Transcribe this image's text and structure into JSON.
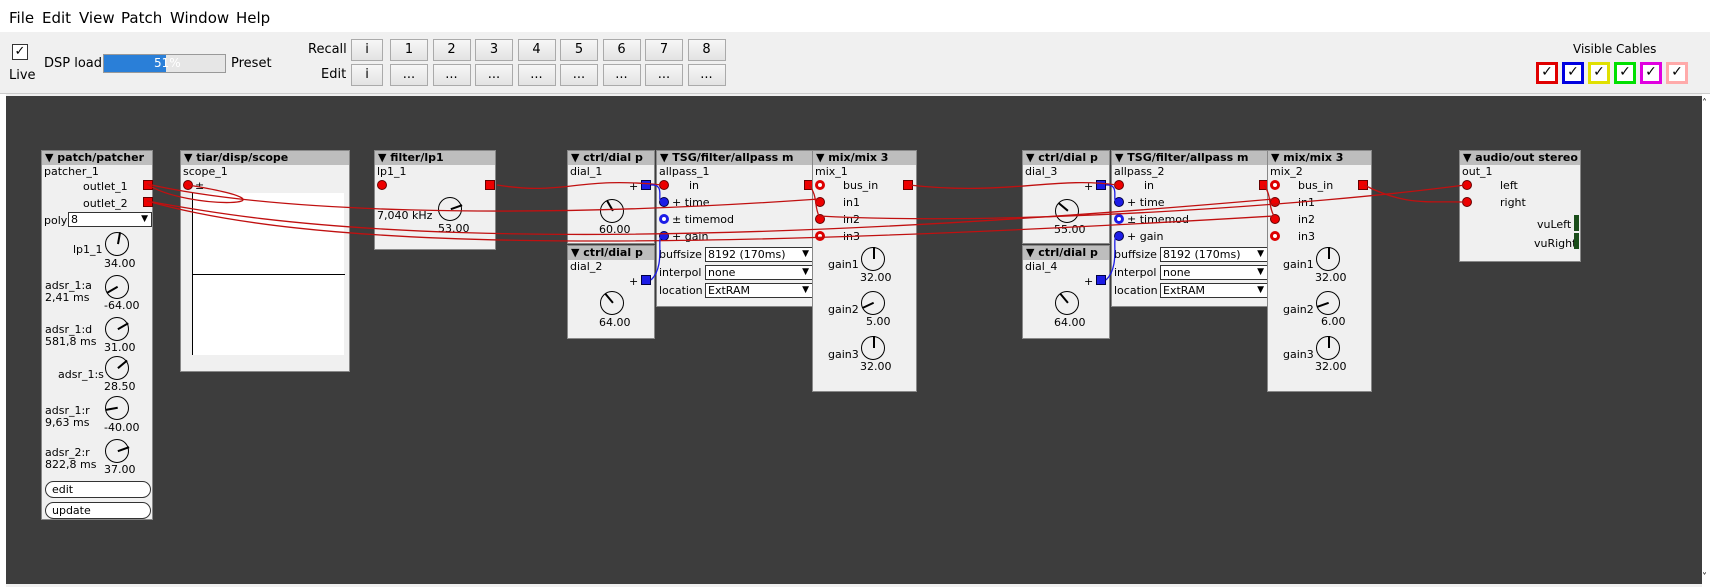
{
  "menu": [
    "File",
    "Edit",
    "View",
    "Patch",
    "Window",
    "Help"
  ],
  "toolbar": {
    "live": "Live",
    "dsp_label": "DSP load",
    "dsp_value": "51%",
    "dsp_fraction": 0.51,
    "preset": "Preset",
    "recall": "Recall",
    "edit": "Edit",
    "recall_buttons": [
      "i",
      "1",
      "2",
      "3",
      "4",
      "5",
      "6",
      "7",
      "8"
    ],
    "edit_buttons": [
      "i",
      "...",
      "...",
      "...",
      "...",
      "...",
      "...",
      "...",
      "..."
    ],
    "visible_cables": "Visible Cables",
    "cable_colors": [
      "#e00000",
      "#0000e0",
      "#e0e000",
      "#00e000",
      "#e000e0",
      "#ffaaaa"
    ]
  },
  "objects": {
    "patcher": {
      "header": "▼ patch/patcher",
      "name": "patcher_1",
      "outlet1": "outlet_1",
      "outlet2": "outlet_2",
      "poly_label": "poly",
      "poly_value": "8",
      "lp1_label": "lp1_1",
      "lp1_value": "34.00",
      "adsr_a_label": "adsr_1:a",
      "adsr_a_sub": "2,41 ms",
      "adsr_a_value": "-64.00",
      "adsr_d_label": "adsr_1:d",
      "adsr_d_sub": "581,8 ms",
      "adsr_d_value": "31.00",
      "adsr_s_label": "adsr_1:s",
      "adsr_s_value": "28.50",
      "adsr_r_label": "adsr_1:r",
      "adsr_r_sub": "9,63 ms",
      "adsr_r_value": "-40.00",
      "adsr2_r_label": "adsr_2:r",
      "adsr2_r_sub": "822,8 ms",
      "adsr2_r_value": "37.00",
      "edit": "edit",
      "update": "update"
    },
    "scope": {
      "header": "▼ tiar/disp/scope",
      "name": "scope_1",
      "plus": "±"
    },
    "lp": {
      "header": "▼ filter/lp1",
      "name": "lp1_1",
      "freq": "7,040 kHz",
      "value": "53.00"
    },
    "dial1": {
      "header": "▼ ctrl/dial p",
      "name": "dial_1",
      "value": "60.00",
      "plus": "+"
    },
    "dial2": {
      "header": "▼ ctrl/dial p",
      "name": "dial_2",
      "value": "64.00",
      "plus": "+"
    },
    "allpass1": {
      "header": "▼ TSG/filter/allpass m",
      "name": "allpass_1",
      "in": "in",
      "time": "+ time",
      "timemod": "± timemod",
      "gain": "+ gain",
      "buffsize_label": "buffsize",
      "buffsize": "8192 (170ms)",
      "interpol_label": "interpol",
      "interpol": "none",
      "location_label": "location",
      "location": "ExtRAM"
    },
    "mix1": {
      "header": "▼ mix/mix 3",
      "name": "mix_1",
      "bus_in": "bus_in",
      "in1": "in1",
      "in2": "in2",
      "in3": "in3",
      "gain1": "gain1",
      "gain1_value": "32.00",
      "gain2": "gain2",
      "gain2_value": "5.00",
      "gain3": "gain3",
      "gain3_value": "32.00"
    },
    "dial3": {
      "header": "▼ ctrl/dial p",
      "name": "dial_3",
      "value": "55.00",
      "plus": "+"
    },
    "dial4": {
      "header": "▼ ctrl/dial p",
      "name": "dial_4",
      "value": "64.00",
      "plus": "+"
    },
    "allpass2": {
      "header": "▼ TSG/filter/allpass m",
      "name": "allpass_2",
      "in": "in",
      "time": "+ time",
      "timemod": "± timemod",
      "gain": "+ gain",
      "buffsize_label": "buffsize",
      "buffsize": "8192 (170ms)",
      "interpol_label": "interpol",
      "interpol": "none",
      "location_label": "location",
      "location": "ExtRAM"
    },
    "mix2": {
      "header": "▼ mix/mix 3",
      "name": "mix_2",
      "bus_in": "bus_in",
      "in1": "in1",
      "in2": "in2",
      "in3": "in3",
      "gain1": "gain1",
      "gain1_value": "32.00",
      "gain2": "gain2",
      "gain2_value": "6.00",
      "gain3": "gain3",
      "gain3_value": "32.00"
    },
    "out": {
      "header": "▼ audio/out stereo",
      "name": "out_1",
      "left": "left",
      "right": "right",
      "vuleft": "vuLeft",
      "vuright": "vuRight"
    }
  }
}
